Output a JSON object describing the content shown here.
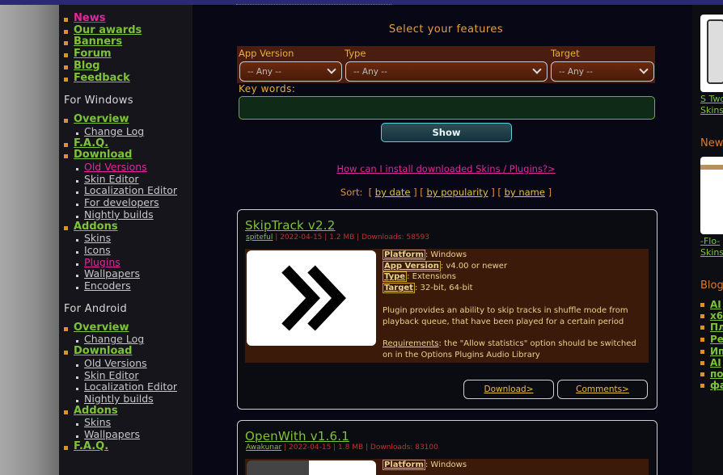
{
  "sidebar": {
    "top_items": [
      {
        "label": "News",
        "color": "#e0289a"
      },
      {
        "label": "Our awards"
      },
      {
        "label": "Banners"
      },
      {
        "label": "Forum"
      },
      {
        "label": "Blog"
      },
      {
        "label": "Feedback"
      }
    ],
    "windows_section": "For Windows",
    "windows": {
      "overview": "Overview",
      "change_log": "Change Log",
      "faq": "F.A.Q.",
      "download": "Download",
      "old_versions": "Old Versions",
      "skin_editor": "Skin Editor",
      "localization_editor": "Localization Editor",
      "for_developers": "For developers",
      "nightly_builds": "Nightly builds",
      "addons": "Addons",
      "skins": "Skins",
      "icons": "Icons",
      "plugins": "Plugins",
      "wallpapers": "Wallpapers",
      "encoders": "Encoders"
    },
    "android_section": "For Android",
    "android": {
      "overview": "Overview",
      "change_log": "Change Log",
      "download": "Download",
      "old_versions": "Old Versions",
      "skin_editor": "Skin Editor",
      "localization_editor": "Localization Editor",
      "nightly_builds": "Nightly builds",
      "addons": "Addons",
      "skins": "Skins",
      "wallpapers": "Wallpapers",
      "faq": "F.A.Q."
    }
  },
  "filters": {
    "title": "Select your features",
    "app_version_label": "App Version",
    "app_version_value": "-- Any --",
    "type_label": "Type",
    "type_value": "-- Any --",
    "target_label": "Target",
    "target_value": "-- Any --",
    "keywords_label": "Key words:",
    "keywords_value": "",
    "show_button": "Show"
  },
  "howto_link": "How can I install downloaded Skins / Plugins?>",
  "sort": {
    "label": "Sort:",
    "by_date": "by date",
    "by_popularity": "by popularity",
    "by_name": "by name"
  },
  "plugins": [
    {
      "title": "SkipTrack v2.2",
      "author": "spiteful",
      "meta": " | 2022-04-15 | 1.2 MB | Downloads: 58593",
      "platform_key": "Platform",
      "platform": ": Windows",
      "app_version_key": "App Version",
      "app_version": ": v4.00 or newer",
      "type_key": "Type",
      "type": ": Extensions",
      "target_key": "Target",
      "target": ": 32-bit, 64-bit",
      "description": "Plugin provides an ability to skip tracks in shuffle mode from playback queue, that have been played for a certain period",
      "requirements_key": "Requirements",
      "requirements": ": the \"Allow statistics\" option should be switched on in the Options Plugins Audio Library",
      "download_button": "Download>",
      "comments_button": "Comments>"
    },
    {
      "title": "OpenWith v1.6.1",
      "author": "Awakunar",
      "meta": " | 2022-04-15 | 1.8 MB | Downloads: 83100",
      "platform_key": "Platform",
      "platform": ": Windows"
    }
  ],
  "right": {
    "promo1_line1": "S Two",
    "promo1_line2": "Skins",
    "news_head": "New",
    "promo2_line1": "-Flo-",
    "promo2_line2": "Skins",
    "blog_head": "Blog",
    "blog_items": [
      "AI",
      "х6",
      "Пл",
      "Ре",
      "Ип",
      "AI",
      "по",
      "фа"
    ]
  },
  "colors": {
    "link_green": "#7ec23a",
    "link_pink": "#e0289a",
    "accent_orange": "#e8903a",
    "filter_bg": "#4a1d10"
  }
}
